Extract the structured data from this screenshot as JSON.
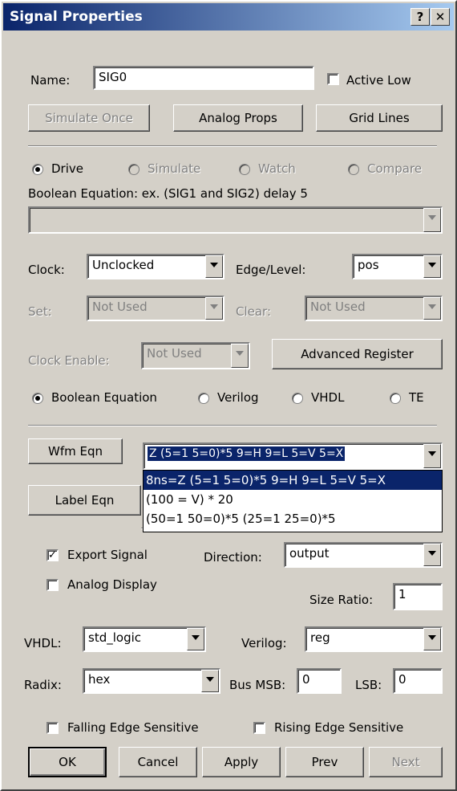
{
  "window": {
    "title": "Signal Properties",
    "help_btn": "?",
    "close_btn": "✕"
  },
  "name_row": {
    "label": "Name:",
    "value": "SIG0",
    "active_low": "Active Low",
    "active_low_checked": false
  },
  "top_buttons": {
    "simulate_once": "Simulate Once",
    "analog_props": "Analog Props",
    "grid_lines": "Grid Lines"
  },
  "mode_radios": {
    "drive": "Drive",
    "simulate": "Simulate",
    "watch": "Watch",
    "compare": "Compare",
    "selected": "drive"
  },
  "boolean_equation": {
    "label": "Boolean Equation: ex. (SIG1 and SIG2) delay 5",
    "value": ""
  },
  "clock": {
    "label": "Clock:",
    "value": "Unclocked",
    "edge_label": "Edge/Level:",
    "edge_value": "pos"
  },
  "set_clear": {
    "set_label": "Set:",
    "set_value": "Not Used",
    "clear_label": "Clear:",
    "clear_value": "Not Used"
  },
  "clock_enable": {
    "label": "Clock Enable:",
    "value": "Not Used",
    "advanced_register": "Advanced Register"
  },
  "lang_radios": {
    "boolean_equation": "Boolean Equation",
    "verilog": "Verilog",
    "vhdl": "VHDL",
    "te": "TE",
    "selected": "boolean_equation"
  },
  "wfm": {
    "button": "Wfm Eqn",
    "value": "Z (5=1 5=0)*5 9=H 9=L 5=V 5=X",
    "options": [
      "8ns=Z (5=1 5=0)*5 9=H 9=L 5=V 5=X",
      "(100 = V) * 20",
      "(50=1 50=0)*5 (25=1 25=0)*5"
    ]
  },
  "label_eqn": {
    "button": "Label Eqn"
  },
  "export": {
    "export_signal": "Export Signal",
    "export_checked": true,
    "direction_label": "Direction:",
    "direction_value": "output"
  },
  "analog": {
    "analog_display": "Analog Display",
    "analog_checked": false,
    "size_ratio_label": "Size Ratio:",
    "size_ratio_value": "1"
  },
  "types": {
    "vhdl_label": "VHDL:",
    "vhdl_value": "std_logic",
    "verilog_label": "Verilog:",
    "verilog_value": "reg"
  },
  "radix": {
    "label": "Radix:",
    "value": "hex",
    "bus_msb_label": "Bus MSB:",
    "bus_msb_value": "0",
    "lsb_label": "LSB:",
    "lsb_value": "0"
  },
  "edges": {
    "falling": "Falling Edge Sensitive",
    "rising": "Rising Edge Sensitive"
  },
  "footer": {
    "ok": "OK",
    "cancel": "Cancel",
    "apply": "Apply",
    "prev": "Prev",
    "next": "Next"
  }
}
